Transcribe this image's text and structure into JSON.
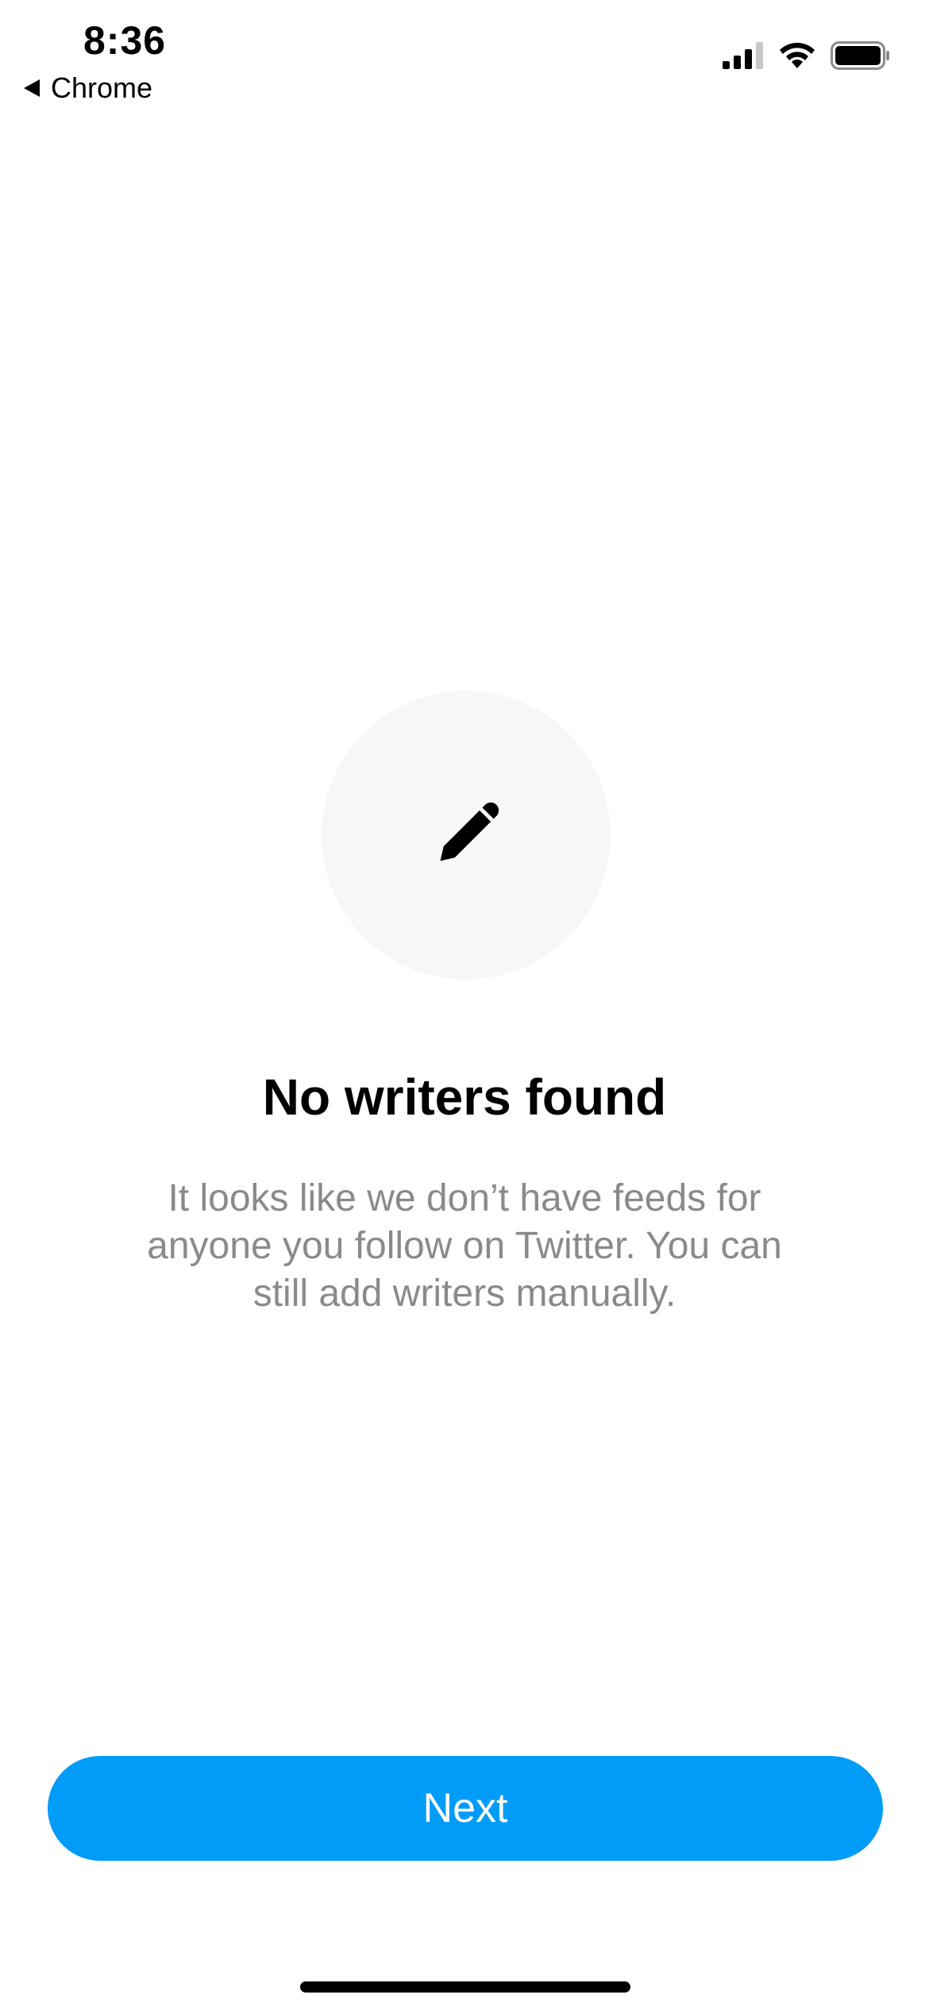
{
  "status_bar": {
    "time": "8:36",
    "back_label": "Chrome",
    "icons": [
      "signal-icon",
      "wifi-icon",
      "battery-icon"
    ]
  },
  "empty_state": {
    "icon": "pencil-icon",
    "title": "No writers found",
    "description": "It looks like we don’t have feeds for anyone you follow on Twitter. You can still add writers manually."
  },
  "actions": {
    "next_label": "Next"
  },
  "colors": {
    "accent": "#009cf7",
    "circle_bg": "#f7f7f5",
    "muted_text": "#8a8a8a"
  }
}
